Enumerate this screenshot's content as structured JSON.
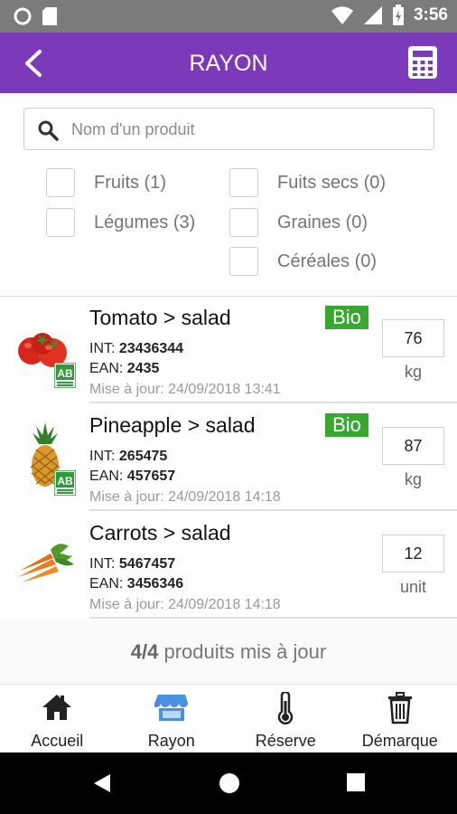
{
  "status_bar": {
    "time": "3:56",
    "icons": [
      "circle-notification-icon",
      "sd-card-icon",
      "wifi-icon",
      "signal-icon",
      "battery-charging-icon"
    ]
  },
  "app_bar": {
    "title": "RAYON",
    "back_icon": "back-arrow-icon",
    "calculator_icon": "calculator-icon",
    "color": "#7c3aba"
  },
  "search": {
    "placeholder": "Nom d'un produit",
    "value": ""
  },
  "filters": [
    {
      "label": "Fruits (1)",
      "checked": false
    },
    {
      "label": "Fuits secs (0)",
      "checked": false
    },
    {
      "label": "Légumes (3)",
      "checked": false
    },
    {
      "label": "Graines (0)",
      "checked": false
    },
    {
      "label": "Céréales (0)",
      "checked": false
    }
  ],
  "products": [
    {
      "name": "Tomato > salad",
      "bio_badge": "Bio",
      "int_label": "INT: ",
      "int_value": "23436344",
      "ean_label": "EAN: ",
      "ean_value": "2435",
      "updated": "Mise à jour: 24/09/2018 13:41",
      "quantity": "76",
      "unit": "kg",
      "image": "tomato-image",
      "ab_label": true
    },
    {
      "name": "Pineapple > salad",
      "bio_badge": "Bio",
      "int_label": "INT: ",
      "int_value": "265475",
      "ean_label": "EAN: ",
      "ean_value": "457657",
      "updated": "Mise à jour: 24/09/2018 14:18",
      "quantity": "87",
      "unit": "kg",
      "image": "pineapple-image",
      "ab_label": true
    },
    {
      "name": "Carrots > salad",
      "bio_badge": "",
      "int_label": "INT: ",
      "int_value": "5467457",
      "ean_label": "EAN: ",
      "ean_value": "3456346",
      "updated": "Mise à jour: 24/09/2018 14:18",
      "quantity": "12",
      "unit": "unit",
      "image": "carrots-image",
      "ab_label": false
    }
  ],
  "summary": {
    "count": "4/4",
    "text": " produits mis à jour"
  },
  "bottom_nav": [
    {
      "label": "Accueil",
      "icon": "home-icon",
      "active": false
    },
    {
      "label": "Rayon",
      "icon": "store-icon",
      "active": true
    },
    {
      "label": "Réserve",
      "icon": "thermometer-icon",
      "active": false
    },
    {
      "label": "Démarque",
      "icon": "trash-icon",
      "active": false
    }
  ],
  "colors": {
    "accent": "#7c3aba",
    "bio_green": "#38a830",
    "active_nav": "#4a90e2"
  }
}
